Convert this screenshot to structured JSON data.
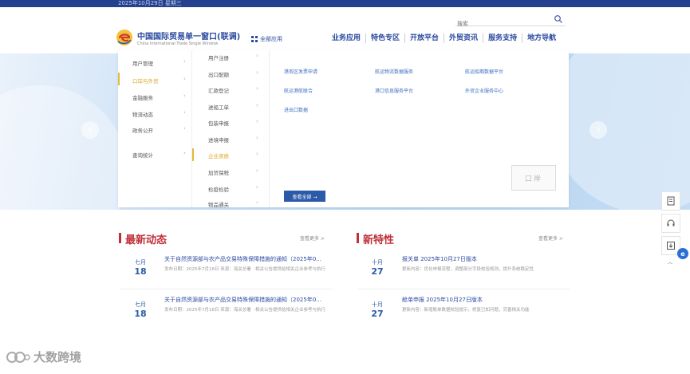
{
  "topbar": {
    "text": "2025年10月29日 星期三"
  },
  "header": {
    "site_name": "中国国际贸易单一窗口(联调)",
    "site_en": "China International Trade Single Window",
    "nav_all": "全部应用",
    "search": {
      "placeholder": "搜索"
    },
    "main_nav": [
      "业务应用",
      "特色专区",
      "开放平台",
      "外贸资讯",
      "服务支持",
      "地方导航"
    ]
  },
  "mega_menu": {
    "col1": [
      "用户管理",
      "口岸与外贸",
      "金融服务",
      "物流动态",
      "政务公开",
      "查询统计"
    ],
    "col2": [
      "用户注册",
      "出口配额",
      "汇款登记",
      "进船工单",
      "包装申报",
      "进境申报",
      "企业资质",
      "加贸保税",
      "检疫检验",
      "物品通关"
    ],
    "links": [
      "港务区发票申请",
      "航运物流数据服务",
      "航运船期数据平台",
      "航运港航联合",
      "港口信息服务平台",
      "外贸企业服务中心",
      "进出口数据"
    ],
    "more_button": "查看全部 →",
    "qr": "口岸"
  },
  "latest_news": {
    "title": "最新动态",
    "more": "查看更多 >",
    "items": [
      {
        "month": "七月",
        "day": "18",
        "title": "关于自然资源部与农产品交易特殊保障措施的通知（2025年0...",
        "sub": "发布日期：2025年7月18日  来源：海关总署 · 相关公告提供给相关企业参考与执行"
      },
      {
        "month": "七月",
        "day": "18",
        "title": "关于自然资源部与农产品交易特殊保障措施的通知（2025年0...",
        "sub": "发布日期：2025年7月18日  来源：海关总署 · 相关公告提供给相关企业参考与执行"
      }
    ]
  },
  "new_features": {
    "title": "新特性",
    "more": "查看更多 >",
    "items": [
      {
        "month": "十月",
        "day": "27",
        "title": "报关单 2025年10月27日版本",
        "sub": "更新内容：优化申报流程，调整部分字段校验规则，提升系统稳定性"
      },
      {
        "month": "十月",
        "day": "27",
        "title": "舱单申报 2025年10月27日版本",
        "sub": "更新内容：新增舱单数据校验提示，修复已知问题，完善相关功能"
      }
    ]
  },
  "watermark": {
    "text": "大数跨境"
  }
}
